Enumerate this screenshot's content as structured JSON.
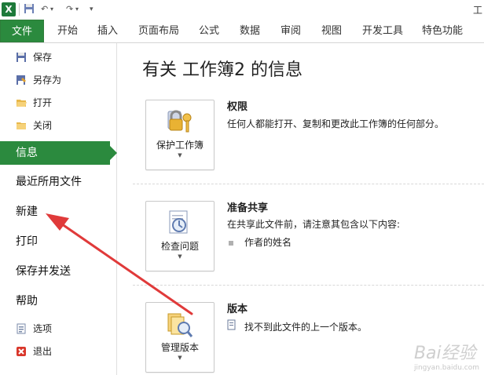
{
  "qat": {
    "app_icon": "X",
    "undo": "↶",
    "redo": "↷",
    "title_fragment": "工"
  },
  "ribbon": {
    "file_tab": "文件",
    "tabs": [
      "开始",
      "插入",
      "页面布局",
      "公式",
      "数据",
      "审阅",
      "视图",
      "开发工具",
      "特色功能"
    ]
  },
  "backstage": {
    "commands": [
      {
        "label": "保存",
        "icon": "save-icon"
      },
      {
        "label": "另存为",
        "icon": "save-as-icon"
      },
      {
        "label": "打开",
        "icon": "open-folder-icon"
      },
      {
        "label": "关闭",
        "icon": "close-folder-icon"
      }
    ],
    "nav": [
      "信息",
      "最近所用文件",
      "新建",
      "打印",
      "保存并发送",
      "帮助"
    ],
    "active_nav": "信息",
    "bottom_commands": [
      {
        "label": "选项",
        "icon": "options-icon"
      },
      {
        "label": "退出",
        "icon": "exit-icon"
      }
    ]
  },
  "info": {
    "heading": "有关 工作簿2 的信息",
    "permissions": {
      "button": "保护工作簿",
      "title": "权限",
      "desc": "任何人都能打开、复制和更改此工作簿的任何部分。"
    },
    "prepare": {
      "button": "检查问题",
      "title": "准备共享",
      "desc": "在共享此文件前，请注意其包含以下内容:",
      "items": [
        "作者的姓名"
      ]
    },
    "versions": {
      "button": "管理版本",
      "title": "版本",
      "desc": "找不到此文件的上一个版本。"
    }
  },
  "watermark": {
    "brand": "Bai经验",
    "url": "jingyan.baidu.com"
  },
  "colors": {
    "accent": "#2b8a3e",
    "arrow": "#e03a3a"
  }
}
